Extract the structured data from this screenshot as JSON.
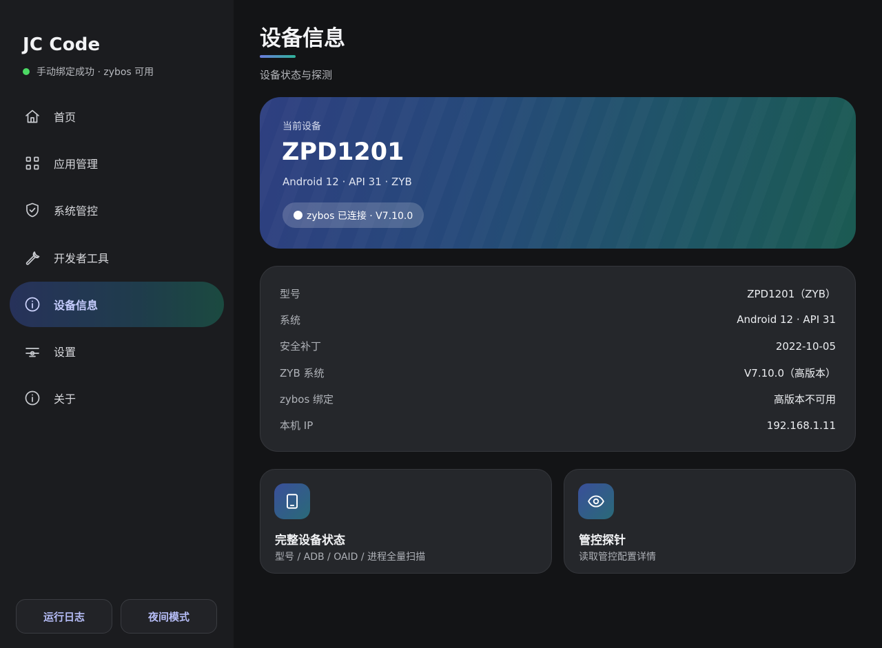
{
  "sidebar": {
    "brand": "JC Code",
    "status": "手动绑定成功 · zybos 可用",
    "status_color": "#4cd964",
    "items": [
      {
        "label": "首页",
        "icon": "home-icon"
      },
      {
        "label": "应用管理",
        "icon": "grid-icon"
      },
      {
        "label": "系统管控",
        "icon": "shield-icon"
      },
      {
        "label": "开发者工具",
        "icon": "wrench-icon"
      },
      {
        "label": "设备信息",
        "icon": "info-icon",
        "active": true
      },
      {
        "label": "设置",
        "icon": "sliders-icon"
      },
      {
        "label": "关于",
        "icon": "info-icon"
      }
    ],
    "buttons": {
      "log": "运行日志",
      "night": "夜间模式"
    }
  },
  "main": {
    "title": "设备信息",
    "subtitle": "设备状态与探测",
    "hero": {
      "label": "当前设备",
      "model": "ZPD1201",
      "system": "Android 12 · API 31 · ZYB",
      "pill": "zybos 已连接 · V7.10.0"
    },
    "info": [
      {
        "key": "型号",
        "value": "ZPD1201（ZYB）"
      },
      {
        "key": "系统",
        "value": "Android 12 · API 31"
      },
      {
        "key": "安全补丁",
        "value": "2022-10-05"
      },
      {
        "key": "ZYB 系统",
        "value": "V7.10.0（高版本）"
      },
      {
        "key": "zybos 绑定",
        "value": "高版本不可用"
      },
      {
        "key": "本机 IP",
        "value": "192.168.1.11"
      }
    ],
    "tiles": [
      {
        "title": "完整设备状态",
        "subtitle": "型号 / ADB / OAID / 进程全量扫描",
        "icon": "tablet-icon"
      },
      {
        "title": "管控探针",
        "subtitle": "读取管控配置详情",
        "icon": "eye-icon"
      }
    ]
  },
  "colors": {
    "accent": "#c6cdff",
    "background": "#131416",
    "card": "#25272b"
  }
}
